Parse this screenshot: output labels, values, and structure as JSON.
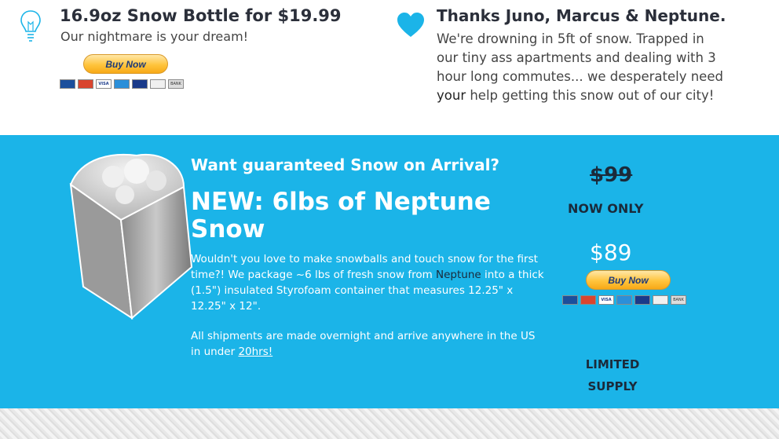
{
  "products": [
    {
      "title": "16.9oz Snow Bottle for $19.99",
      "subtitle": "Our nightmare is your dream!",
      "buy_label": "Buy Now"
    }
  ],
  "thanks": {
    "title": "Thanks Juno, Marcus & Neptune.",
    "body_lines": [
      "We're drowning in 5ft of snow. Trapped in",
      "our tiny ass apartments and dealing with 3",
      "hour long commutes... we desperately need"
    ],
    "body_your": "your",
    "body_end": " help getting this snow out of our city!"
  },
  "offer": {
    "headline": "Want guaranteed Snow on Arrival?",
    "title": "NEW: 6lbs of Neptune Snow",
    "desc_a": "Wouldn't you love to make snowballs and touch snow for the first time?! We package ~6 lbs of fresh snow from ",
    "desc_link": "Neptune",
    "desc_b": " into a thick (1.5\") insulated Styrofoam container that measures 12.25\" x 12.25\" x 12\".",
    "desc2_a": "All shipments are made overnight and arrive anywhere in the US in under ",
    "desc2_link": "20hrs!",
    "old_price": "$99",
    "now_only": "NOW ONLY",
    "price": "$89",
    "buy_label": "Buy Now",
    "limited_1": "LIMITED",
    "limited_2": "SUPPLY"
  },
  "cards": [
    "Maestro",
    "MasterCard",
    "VISA",
    "Amex",
    "Visa Electron",
    "Discover",
    "Bank"
  ],
  "colors": {
    "blue_section": "#1bb4e8",
    "heart": "#1bb4e8",
    "dark_text": "#1b2a3a",
    "share_strip": [
      "#3b8fd1",
      "#2b9bdc",
      "#d9452f",
      "#e8e8e8",
      "#777777"
    ]
  }
}
